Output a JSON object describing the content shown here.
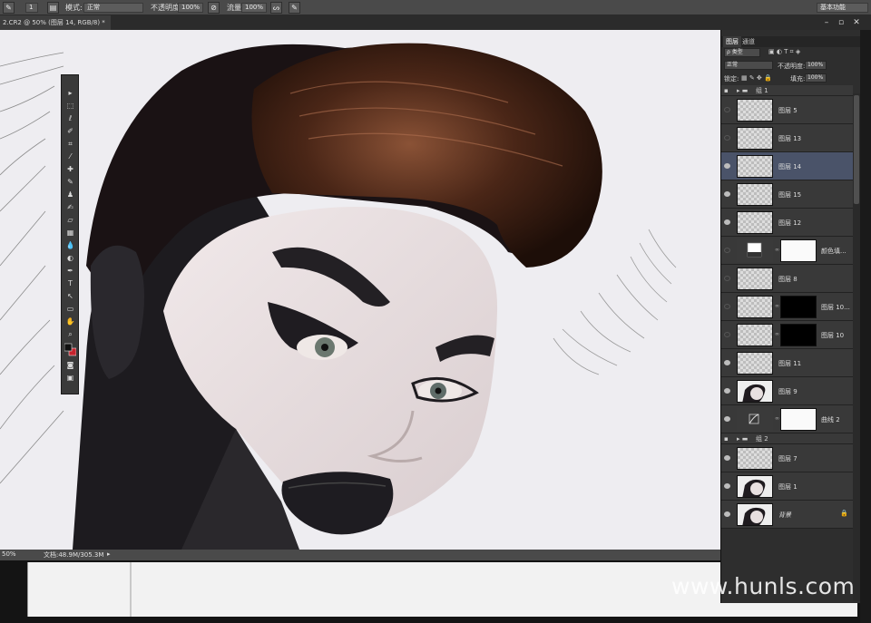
{
  "options_bar": {
    "brush_size": "1",
    "mode_label": "模式:",
    "mode_value": "正常",
    "opacity_label": "不透明度:",
    "opacity_value": "100%",
    "flow_label": "流量:",
    "flow_value": "100%",
    "workspace": "基本功能"
  },
  "document_tab": {
    "title": "2.CR2 @ 50% (图层 14, RGB/8) *"
  },
  "window_controls": {
    "minimize": "–",
    "restore": "▫",
    "close": "✕"
  },
  "status_bar": {
    "zoom": "50%",
    "doc_size": "文档:48.9M/305.3M"
  },
  "layers_panel": {
    "tabs": [
      "图层",
      "通道"
    ],
    "filter_label": "ρ 类型",
    "blend_mode": "正常",
    "opacity_label": "不透明度:",
    "opacity_value": "100%",
    "lock_label": "锁定:",
    "fill_label": "填充:",
    "fill_value": "100%",
    "group1": "组 1",
    "group2": "组 2",
    "layers": [
      {
        "name": "图层 5"
      },
      {
        "name": "图层 13"
      },
      {
        "name": "图层 14"
      },
      {
        "name": "图层 15"
      },
      {
        "name": "图层 12"
      },
      {
        "name": "颜色填..."
      },
      {
        "name": "图层 8"
      },
      {
        "name": "图层 10..."
      },
      {
        "name": "图层 10"
      },
      {
        "name": "图层 11"
      },
      {
        "name": "图层 9"
      },
      {
        "name": "曲线 2"
      },
      {
        "name": "图层 7"
      },
      {
        "name": "图层 1"
      },
      {
        "name": "背景"
      }
    ]
  },
  "watermark": "www.hunls.com"
}
